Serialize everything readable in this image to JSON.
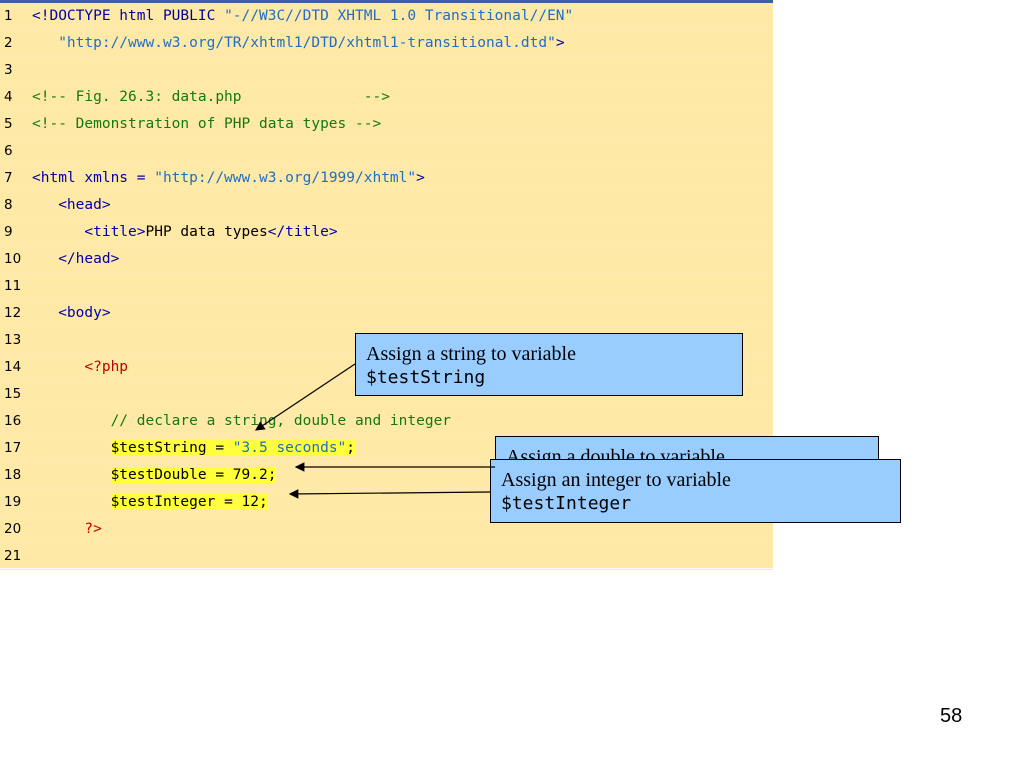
{
  "code_lines": [
    {
      "num": "1",
      "segments": [
        {
          "text": "<!DOCTYPE html PUBLIC ",
          "cls": "t-tag"
        },
        {
          "text": "\"-//W3C//DTD XHTML 1.0 Transitional//EN\"",
          "cls": "t-str"
        }
      ]
    },
    {
      "num": "2",
      "segments": [
        {
          "text": "   ",
          "cls": "t-tag"
        },
        {
          "text": "\"http://www.w3.org/TR/xhtml1/DTD/xhtml1-transitional.dtd\"",
          "cls": "t-str"
        },
        {
          "text": ">",
          "cls": "t-tag"
        }
      ]
    },
    {
      "num": "3",
      "segments": []
    },
    {
      "num": "4",
      "segments": [
        {
          "text": "<!-- Fig. 26.3: data.php              -->",
          "cls": "t-com"
        }
      ]
    },
    {
      "num": "5",
      "segments": [
        {
          "text": "<!-- Demonstration of PHP data types -->",
          "cls": "t-com"
        }
      ]
    },
    {
      "num": "6",
      "segments": []
    },
    {
      "num": "7",
      "segments": [
        {
          "text": "<html xmlns = ",
          "cls": "t-tag"
        },
        {
          "text": "\"http://www.w3.org/1999/xhtml\"",
          "cls": "t-str"
        },
        {
          "text": ">",
          "cls": "t-tag"
        }
      ]
    },
    {
      "num": "8",
      "segments": [
        {
          "text": "   <head>",
          "cls": "t-tag"
        }
      ]
    },
    {
      "num": "9",
      "segments": [
        {
          "text": "      <title>",
          "cls": "t-tag"
        },
        {
          "text": "PHP data types",
          "cls": "t-black"
        },
        {
          "text": "</title>",
          "cls": "t-tag"
        }
      ]
    },
    {
      "num": "10",
      "segments": [
        {
          "text": "   </head>",
          "cls": "t-tag"
        }
      ]
    },
    {
      "num": "11",
      "segments": []
    },
    {
      "num": "12",
      "segments": [
        {
          "text": "   <body>",
          "cls": "t-tag"
        }
      ]
    },
    {
      "num": "13",
      "segments": []
    },
    {
      "num": "14",
      "segments": [
        {
          "text": "      <?php",
          "cls": "t-php"
        }
      ]
    },
    {
      "num": "15",
      "segments": []
    },
    {
      "num": "16",
      "segments": [
        {
          "text": "         // declare a string, double and integer",
          "cls": "t-com"
        }
      ]
    },
    {
      "num": "17",
      "segments": [
        {
          "text": "         ",
          "cls": "t-black"
        },
        {
          "text": "$testString = ",
          "cls": "t-black",
          "hl": true
        },
        {
          "text": "\"3.5 seconds\"",
          "cls": "t-str",
          "hl": true
        },
        {
          "text": ";",
          "cls": "t-black",
          "hl": true
        }
      ]
    },
    {
      "num": "18",
      "segments": [
        {
          "text": "         ",
          "cls": "t-black"
        },
        {
          "text": "$testDouble = ",
          "cls": "t-black",
          "hl": true
        },
        {
          "text": "79.2",
          "cls": "t-num",
          "hl": true
        },
        {
          "text": ";",
          "cls": "t-black",
          "hl": true
        }
      ]
    },
    {
      "num": "19",
      "segments": [
        {
          "text": "         ",
          "cls": "t-black"
        },
        {
          "text": "$testInteger = ",
          "cls": "t-black",
          "hl": true
        },
        {
          "text": "12",
          "cls": "t-num",
          "hl": true
        },
        {
          "text": ";",
          "cls": "t-black",
          "hl": true
        }
      ]
    },
    {
      "num": "20",
      "segments": [
        {
          "text": "      ?>",
          "cls": "t-php"
        }
      ]
    },
    {
      "num": "21",
      "segments": []
    }
  ],
  "callouts": {
    "string": {
      "text": "Assign a string to variable",
      "var": "$testString"
    },
    "double": {
      "text": "Assign a double to variable"
    },
    "integer": {
      "text": "Assign an integer to variable",
      "var": "$testInteger"
    }
  },
  "slide_number": "58",
  "colors": {
    "panel_bg": "#ffe9a6",
    "callout_bg": "#99ccff",
    "highlight": "#ffff3c"
  }
}
